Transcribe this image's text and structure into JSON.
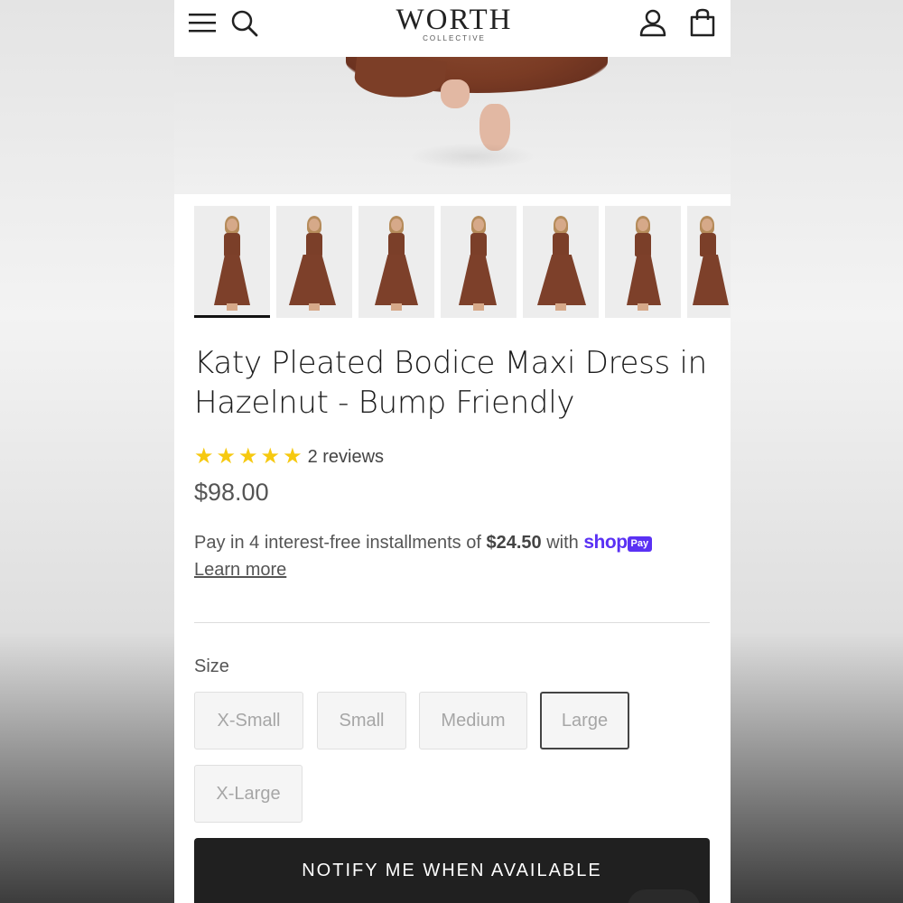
{
  "header": {
    "logo_main": "WORTH",
    "logo_sub": "COLLECTIVE"
  },
  "icons": {
    "menu": "menu-icon",
    "search": "search-icon",
    "account": "account-icon",
    "bag": "bag-icon",
    "star": "star-icon"
  },
  "colors": {
    "star": "#f6c910",
    "shop_pay": "#5a31f4",
    "button_dark": "#202020",
    "dress": "#7b3f29"
  },
  "product": {
    "title": "Katy Pleated Bodice Maxi Dress in Hazelnut - Bump Friendly",
    "rating_stars": 5,
    "reviews": "2 reviews",
    "price": "$98.00"
  },
  "installments": {
    "text_before": "Pay in 4 interest-free installments of",
    "amount": "$24.50",
    "text_with": "with",
    "shop_logo": "shop",
    "pay_badge": "Pay",
    "learn_more": "Learn more"
  },
  "size": {
    "label": "Size",
    "options": [
      "X-Small",
      "Small",
      "Medium",
      "Large",
      "X-Large"
    ],
    "selected": "Large"
  },
  "cta": {
    "notify_label": "NOTIFY ME WHEN AVAILABLE"
  },
  "thumbnails": {
    "count": 7,
    "active_index": 0
  }
}
